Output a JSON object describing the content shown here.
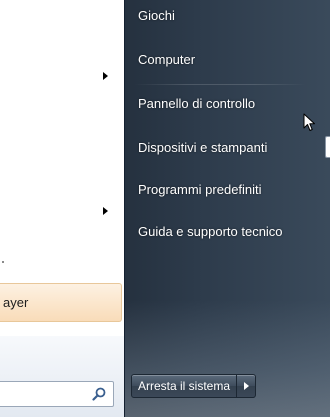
{
  "left_pane": {
    "highlighted_program": "ayer",
    "search": {
      "value": "",
      "placeholder": ""
    }
  },
  "right_pane": {
    "items": [
      {
        "label": "Giochi"
      },
      {
        "label": "Computer"
      },
      {
        "label": "Pannello di controllo"
      },
      {
        "label": "Dispositivi e stampanti"
      },
      {
        "label": "Programmi predefiniti"
      },
      {
        "label": "Guida e supporto tecnico"
      }
    ]
  },
  "shutdown": {
    "label": "Arresta il sistema"
  },
  "icons": {
    "submenu_arrow": "submenu-arrow-icon",
    "search": "search-icon",
    "cursor": "mouse-cursor-icon",
    "shutdown_options": "chevron-right-icon"
  },
  "colors": {
    "right_pane_bg": "#2d3b4b",
    "highlight_bg": "#f9dcb9",
    "search_bg": "#ffffff"
  }
}
